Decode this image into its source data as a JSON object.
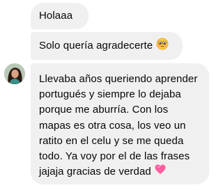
{
  "messages": [
    {
      "text": "Holaaa"
    },
    {
      "text": "Solo quería agradecerte",
      "emoji": "pleading-face-icon"
    },
    {
      "text": "Llevaba años queriendo aprender\nportugués y siempre lo dejaba\nporque me aburría. Con los\nmapas es otra cosa, los veo un\nratito en el celu y se me queda\ntodo. Ya voy por el de las frases\njajaja gracias de verdad",
      "emoji": "heart-icon"
    }
  ],
  "colors": {
    "bubble_bg": "#f0f0f0",
    "text": "#050505",
    "heart": "#ff5fa0",
    "face": "#ffc83d"
  }
}
